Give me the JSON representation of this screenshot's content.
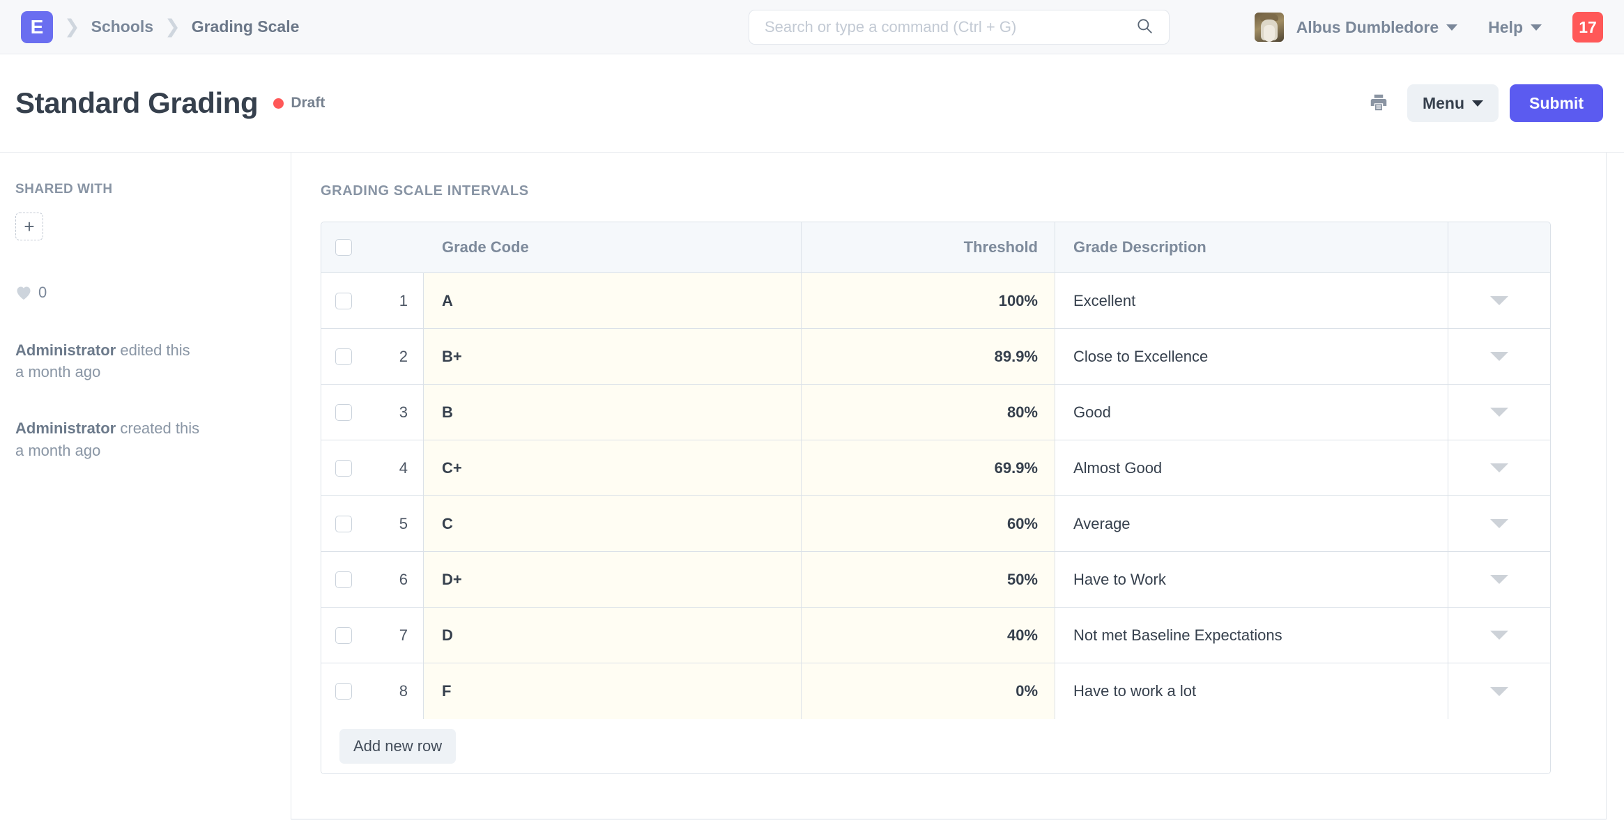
{
  "navbar": {
    "logo_text": "E",
    "breadcrumbs": [
      {
        "label": "Schools"
      },
      {
        "label": "Grading Scale"
      }
    ],
    "search": {
      "placeholder": "Search or type a command (Ctrl + G)",
      "value": "",
      "icon": "search-icon"
    },
    "user": {
      "name": "Albus Dumbledore",
      "avatar_alt": "Albus Dumbledore"
    },
    "help_label": "Help",
    "notifications_count": "17",
    "accent_color": "#6a6ef0",
    "badge_color": "#ff5858"
  },
  "titlebar": {
    "title": "Standard Grading",
    "status_label": "Draft",
    "status_color": "#ff5858",
    "print_icon": "printer-icon",
    "menu_label": "Menu",
    "submit_label": "Submit",
    "submit_color": "#5b5bf0"
  },
  "sidebar": {
    "shared_heading": "SHARED WITH",
    "add_share_label": "+",
    "like_icon": "heart-icon",
    "like_count": "0",
    "activity": [
      {
        "user": "Administrator",
        "action": " edited this",
        "time": "a month ago"
      },
      {
        "user": "Administrator",
        "action": " created this",
        "time": "a month ago"
      }
    ]
  },
  "main": {
    "section_label": "GRADING SCALE INTERVALS",
    "table": {
      "columns": {
        "grade_code": "Grade Code",
        "threshold": "Threshold",
        "grade_description": "Grade Description"
      },
      "rows": [
        {
          "idx": "1",
          "grade_code": "A",
          "threshold": "100%",
          "grade_description": "Excellent"
        },
        {
          "idx": "2",
          "grade_code": "B+",
          "threshold": "89.9%",
          "grade_description": "Close to Excellence"
        },
        {
          "idx": "3",
          "grade_code": "B",
          "threshold": "80%",
          "grade_description": "Good"
        },
        {
          "idx": "4",
          "grade_code": "C+",
          "threshold": "69.9%",
          "grade_description": "Almost Good"
        },
        {
          "idx": "5",
          "grade_code": "C",
          "threshold": "60%",
          "grade_description": "Average"
        },
        {
          "idx": "6",
          "grade_code": "D+",
          "threshold": "50%",
          "grade_description": "Have to Work"
        },
        {
          "idx": "7",
          "grade_code": "D",
          "threshold": "40%",
          "grade_description": "Not met Baseline Expectations"
        },
        {
          "idx": "8",
          "grade_code": "F",
          "threshold": "0%",
          "grade_description": "Have to work a lot"
        }
      ],
      "add_row_label": "Add new row",
      "row_menu_icon": "caret-down-icon",
      "editable_cell_color": "#fffdf3"
    }
  }
}
